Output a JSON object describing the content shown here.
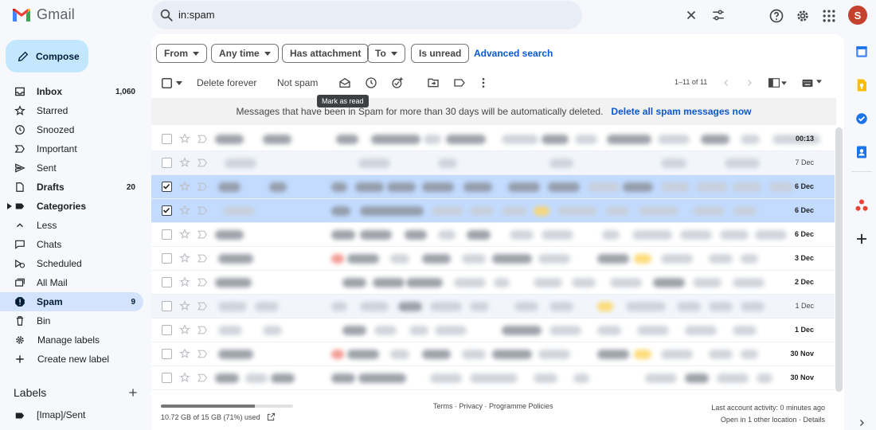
{
  "app": {
    "name": "Gmail",
    "user_initial": "S"
  },
  "search": {
    "query": "in:spam"
  },
  "compose_label": "Compose",
  "nav": [
    {
      "label": "Inbox",
      "count": "1,060",
      "bold": true
    },
    {
      "label": "Starred"
    },
    {
      "label": "Snoozed"
    },
    {
      "label": "Important"
    },
    {
      "label": "Sent"
    },
    {
      "label": "Drafts",
      "count": "20",
      "bold": true
    },
    {
      "label": "Categories",
      "bold": true
    },
    {
      "label": "Less"
    },
    {
      "label": "Chats"
    },
    {
      "label": "Scheduled"
    },
    {
      "label": "All Mail"
    },
    {
      "label": "Spam",
      "count": "9",
      "active": true
    },
    {
      "label": "Bin"
    },
    {
      "label": "Manage labels"
    },
    {
      "label": "Create new label"
    }
  ],
  "labels": {
    "heading": "Labels",
    "items": [
      "[Imap]/Sent"
    ]
  },
  "filters": [
    "From",
    "Any time",
    "Has attachment",
    "To",
    "Is unread"
  ],
  "advanced_search": "Advanced search",
  "toolbar": {
    "delete_forever": "Delete forever",
    "not_spam": "Not spam",
    "tooltip": "Mark as read",
    "pager": "1–11 of 11"
  },
  "notice": {
    "text": "Messages that have been in Spam for more than 30 days will be automatically deleted.",
    "link": "Delete all spam messages now"
  },
  "emails": [
    {
      "date": "00:13",
      "read": false,
      "selected": false
    },
    {
      "date": "7 Dec",
      "read": true,
      "selected": false
    },
    {
      "date": "6 Dec",
      "read": false,
      "selected": true
    },
    {
      "date": "6 Dec",
      "read": false,
      "selected": true
    },
    {
      "date": "6 Dec",
      "read": false,
      "selected": false
    },
    {
      "date": "3 Dec",
      "read": false,
      "selected": false
    },
    {
      "date": "2 Dec",
      "read": false,
      "selected": false
    },
    {
      "date": "1 Dec",
      "read": true,
      "selected": false
    },
    {
      "date": "1 Dec",
      "read": false,
      "selected": false
    },
    {
      "date": "30 Nov",
      "read": false,
      "selected": false
    },
    {
      "date": "30 Nov",
      "read": false,
      "selected": false
    }
  ],
  "storage": {
    "text": "10.72 GB of 15 GB (71%) used",
    "fraction": 0.71
  },
  "footer": {
    "links": "Terms · Privacy · Programme Policies",
    "activity": "Last account activity: 0 minutes ago",
    "other": "Open in 1 other location · Details"
  },
  "colors": {
    "accent": "#0b57d0",
    "selected": "#c2dbff",
    "active_nav": "#d3e3fd",
    "compose": "#c2e7ff"
  }
}
